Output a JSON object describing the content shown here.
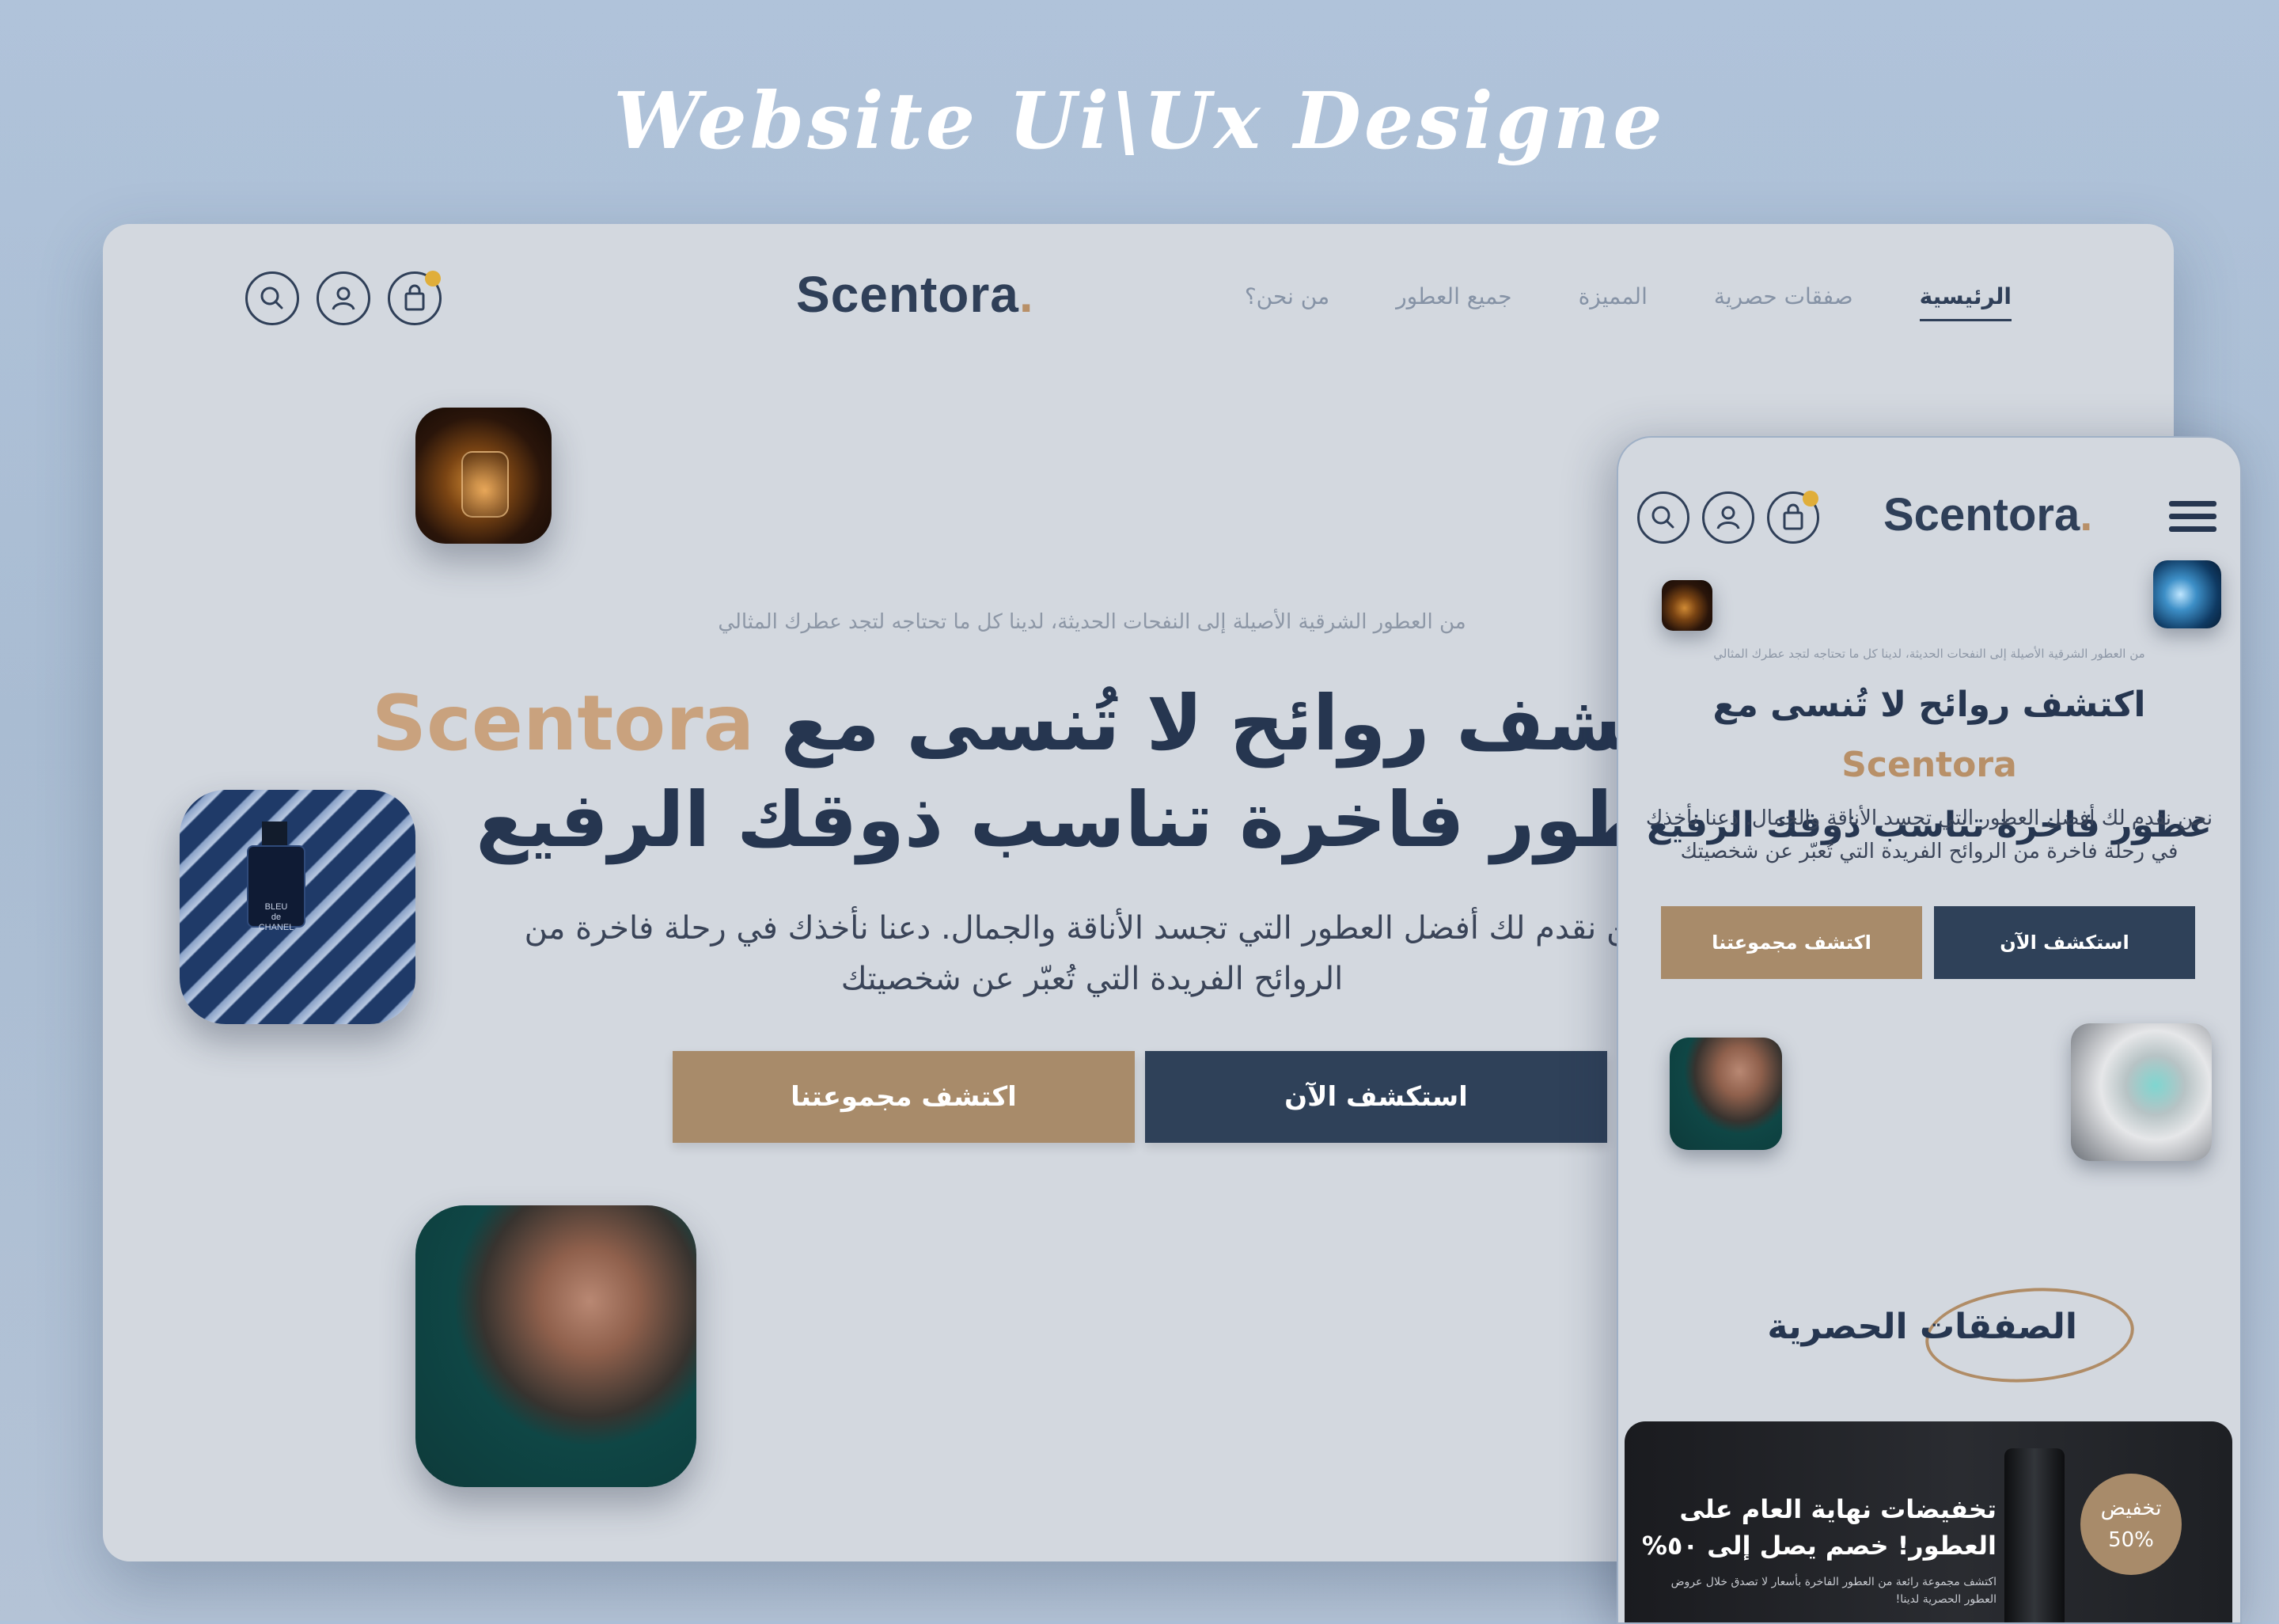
{
  "showcase": {
    "title": "Website Ui\\Ux Designe"
  },
  "brand": {
    "name": "Scentora",
    "dot": "."
  },
  "desktop": {
    "nav": {
      "items": [
        "الرئيسية",
        "صفقات حصرية",
        "المميزة",
        "جميع العطور",
        "من نحن؟"
      ],
      "active_index": 0
    },
    "hero": {
      "tagline": "من العطور الشرقية الأصيلة إلى النفحات الحديثة، لدينا كل ما تحتاجه لتجد عطرك المثالي",
      "headline_line1": "اكتشف روائح لا تُنسى مع",
      "headline_brand": "Scentora",
      "headline_line2": "عطور فاخرة تناسب ذوقك الرفيع",
      "description_line1": "نحن نقدم لك أفضل العطور التي تجسد الأناقة والجمال. دعنا نأخذك في رحلة فاخرة من",
      "description_line2": "الروائح الفريدة التي تُعبّر عن شخصيتك",
      "btn_explore": "استكشف الآن",
      "btn_collection": "اكتشف مجموعتنا"
    },
    "product_label": "BLEU\nde\nCHANEL"
  },
  "mobile": {
    "hero": {
      "tagline": "من العطور الشرقية الأصيلة إلى النفحات الحديثة، لدينا كل ما تحتاجه لتجد عطرك المثالي",
      "headline_line1": "اكتشف روائح لا تُنسى مع",
      "headline_brand": "Scentora",
      "headline_line2": "عطور فاخرة تناسب ذوقك الرفيع",
      "description": "نحن نقدم لك أفضل العطور التي تجسد الأناقة والجمال. دعنا نأخذك في رحلة فاخرة من الروائح الفريدة التي تُعبّر عن شخصيتك",
      "btn_explore": "استكشف الآن",
      "btn_collection": "اكتشف مجموعتنا"
    },
    "deals": {
      "section_title": "الصفقات الحصرية",
      "promo_title": "تخفيضات نهاية العام على العطور! خصم يصل إلى ٥٠%",
      "promo_subtitle": "اكتشف مجموعة رائعة من العطور الفاخرة بأسعار لا تصدق خلال عروض العطور الحصرية لدينا!",
      "badge_label": "تخفيض",
      "badge_value": "50%"
    }
  },
  "icons": [
    "search-icon",
    "user-icon",
    "cart-icon",
    "menu-icon"
  ],
  "colors": {
    "primary": "#2f4159",
    "accent": "#a88b6a",
    "brand_highlight": "#c9a27e",
    "cart_badge": "#e0ae3a"
  }
}
